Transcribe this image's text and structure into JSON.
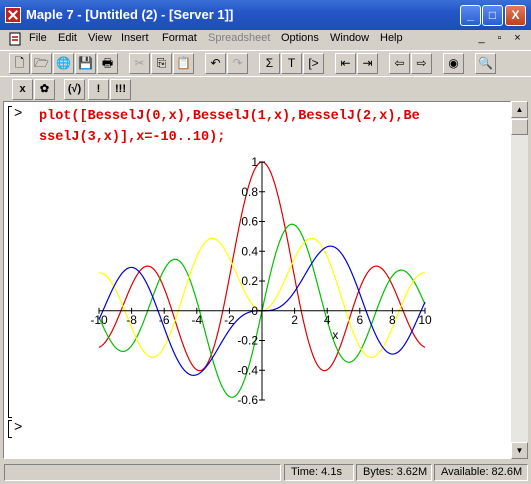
{
  "window": {
    "title": "Maple 7  - [Untitled (2) - [Server 1]]",
    "controls": {
      "minimize": "_",
      "maximize": "□",
      "close": "X"
    }
  },
  "menubar": {
    "items": [
      "File",
      "Edit",
      "View",
      "Insert",
      "Format",
      "Spreadsheet",
      "Options",
      "Window",
      "Help"
    ],
    "disabled": [
      "Spreadsheet"
    ],
    "mdi_controls": {
      "minimize": "_",
      "restore": "▫",
      "close": "×"
    }
  },
  "toolbar1": {
    "buttons": [
      {
        "name": "new-icon",
        "glyph": "🗋"
      },
      {
        "name": "open-icon",
        "glyph": "🗁"
      },
      {
        "name": "open-url-icon",
        "glyph": "🌐"
      },
      {
        "name": "save-icon",
        "glyph": "💾"
      },
      {
        "name": "print-icon",
        "glyph": "🖶"
      },
      {
        "name": "cut-icon",
        "glyph": "✂"
      },
      {
        "name": "copy-icon",
        "glyph": "⎘"
      },
      {
        "name": "paste-icon",
        "glyph": "📋"
      },
      {
        "name": "undo-icon",
        "glyph": "↶"
      },
      {
        "name": "redo-icon",
        "glyph": "↷"
      },
      {
        "name": "sigma-icon",
        "glyph": "Σ"
      },
      {
        "name": "text-icon",
        "glyph": "T"
      },
      {
        "name": "prompt-icon",
        "glyph": "[>"
      },
      {
        "name": "outdent-icon",
        "glyph": "⇤"
      },
      {
        "name": "indent-icon",
        "glyph": "⇥"
      },
      {
        "name": "back-icon",
        "glyph": "⇦"
      },
      {
        "name": "forward-icon",
        "glyph": "⇨"
      },
      {
        "name": "stop-icon",
        "glyph": "◉"
      },
      {
        "name": "zoom-icon",
        "glyph": "🔍"
      }
    ]
  },
  "toolbar2": {
    "buttons": [
      {
        "name": "math-mode-icon",
        "glyph": "x"
      },
      {
        "name": "maple-leaf-icon",
        "glyph": "✿"
      },
      {
        "name": "auto-correct-icon",
        "glyph": "(√)"
      },
      {
        "name": "execute-icon",
        "glyph": "!"
      },
      {
        "name": "execute-all-icon",
        "glyph": "!!!"
      }
    ]
  },
  "worksheet": {
    "prompt": ">",
    "command_line1": "plot([BesselJ(0,x),BesselJ(1,x),BesselJ(2,x),Be",
    "command_line2": "sselJ(3,x)],x=-10..10);",
    "next_prompt": ">"
  },
  "chart_data": {
    "type": "line",
    "title": "",
    "xlabel": "x",
    "ylabel": "",
    "xlim": [
      -10,
      10
    ],
    "ylim": [
      -0.6,
      1
    ],
    "x_ticks": [
      "-10",
      "-8",
      "-6",
      "-4",
      "-2",
      "0",
      "2",
      "4",
      "6",
      "8",
      "10"
    ],
    "y_ticks": [
      "-0.6",
      "-0.4",
      "-0.2",
      "0",
      "0.2",
      "0.4",
      "0.6",
      "0.8",
      "1"
    ],
    "grid": false,
    "series": [
      {
        "function": "BesselJ(0,x)",
        "color": "#e00000"
      },
      {
        "function": "BesselJ(1,x)",
        "color": "#00c000"
      },
      {
        "function": "BesselJ(2,x)",
        "color": "#ffff00"
      },
      {
        "function": "BesselJ(3,x)",
        "color": "#0000e0"
      }
    ]
  },
  "statusbar": {
    "time": "Time:   4.1s",
    "bytes": "Bytes: 3.62M",
    "available": "Available: 82.6M"
  }
}
